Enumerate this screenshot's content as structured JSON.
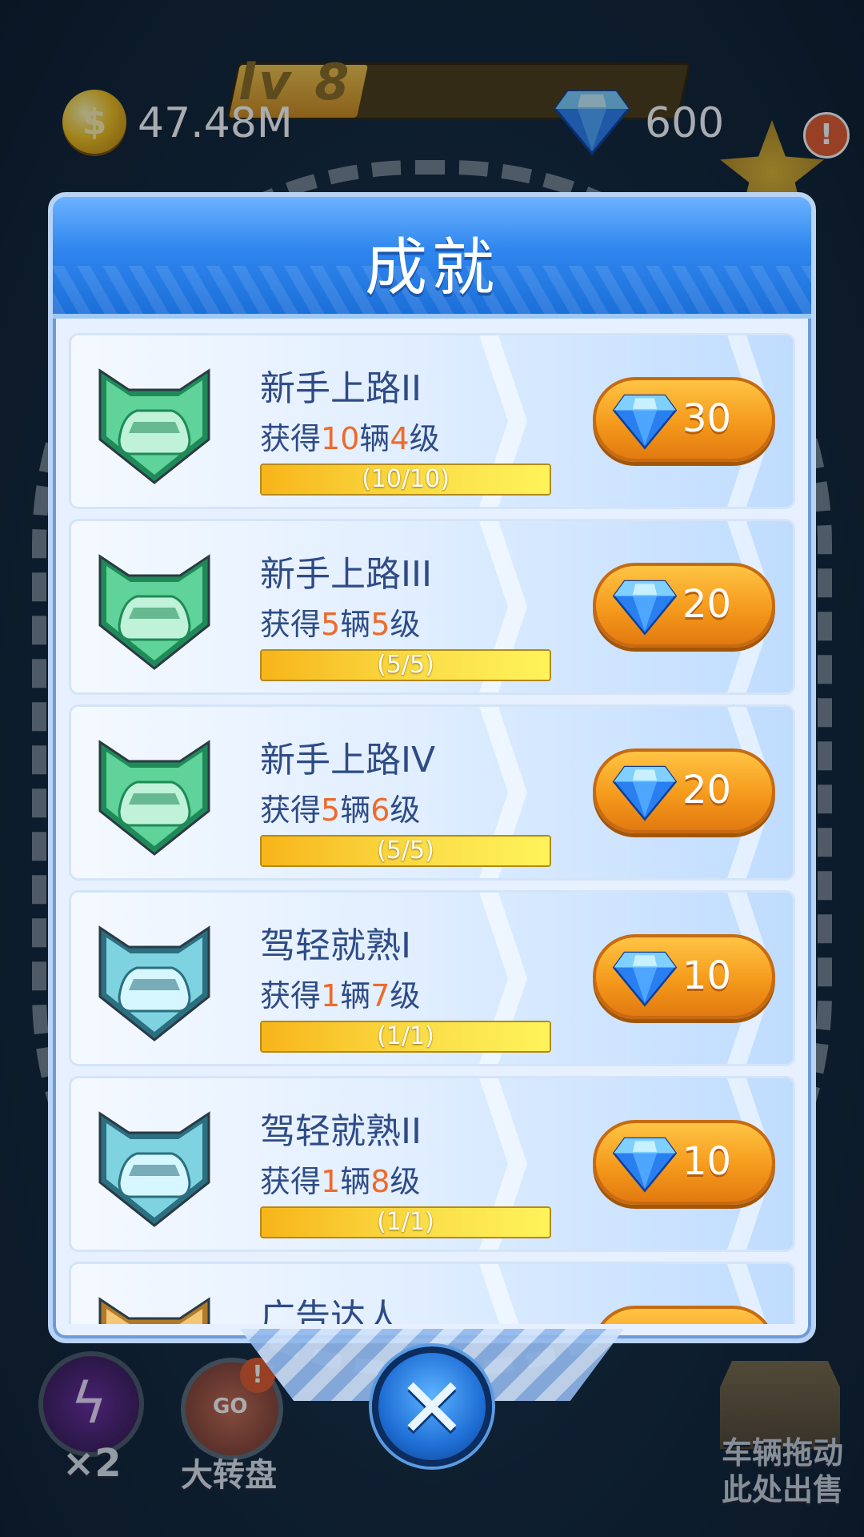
{
  "hud": {
    "level_text": "lv 8",
    "coins": "47.48M",
    "gems": "600",
    "alert_mark": "!",
    "alert_mark_wheel": "!"
  },
  "bottom_bar": {
    "double_label": "×2",
    "wheel_label": "大转盘",
    "wheel_go": "GO",
    "sell_label": "车辆拖动此处出售"
  },
  "modal": {
    "title": "成就",
    "close_symbol": "✕"
  },
  "achievements": [
    {
      "name": "新手上路II",
      "desc_pre": "获得",
      "count": "10",
      "desc_mid": "辆",
      "level": "4",
      "desc_post": "级",
      "progress_text": "(10/10)",
      "progress": 1.0,
      "reward": "30",
      "badge": "green-car-badge"
    },
    {
      "name": "新手上路III",
      "desc_pre": "获得",
      "count": "5",
      "desc_mid": "辆",
      "level": "5",
      "desc_post": "级",
      "progress_text": "(5/5)",
      "progress": 1.0,
      "reward": "20",
      "badge": "green-car-badge"
    },
    {
      "name": "新手上路IV",
      "desc_pre": "获得",
      "count": "5",
      "desc_mid": "辆",
      "level": "6",
      "desc_post": "级",
      "progress_text": "(5/5)",
      "progress": 1.0,
      "reward": "20",
      "badge": "green-car-badge"
    },
    {
      "name": "驾轻就熟I",
      "desc_pre": "获得",
      "count": "1",
      "desc_mid": "辆",
      "level": "7",
      "desc_post": "级",
      "progress_text": "(1/1)",
      "progress": 1.0,
      "reward": "10",
      "badge": "teal-car-badge"
    },
    {
      "name": "驾轻就熟II",
      "desc_pre": "获得",
      "count": "1",
      "desc_mid": "辆",
      "level": "8",
      "desc_post": "级",
      "progress_text": "(1/1)",
      "progress": 1.0,
      "reward": "10",
      "badge": "teal-car-badge"
    },
    {
      "name": "广告达人",
      "desc_pre": "",
      "count": "",
      "desc_mid": "",
      "level": "",
      "desc_post": "",
      "progress_text": "",
      "progress": 0,
      "reward": "",
      "badge": "gold-star-badge"
    }
  ],
  "colors": {
    "highlight": "#ee6a2a",
    "text_blue": "#2e4b86",
    "header_blue": "#2f86ee",
    "reward_orange": "#f59a1c"
  }
}
